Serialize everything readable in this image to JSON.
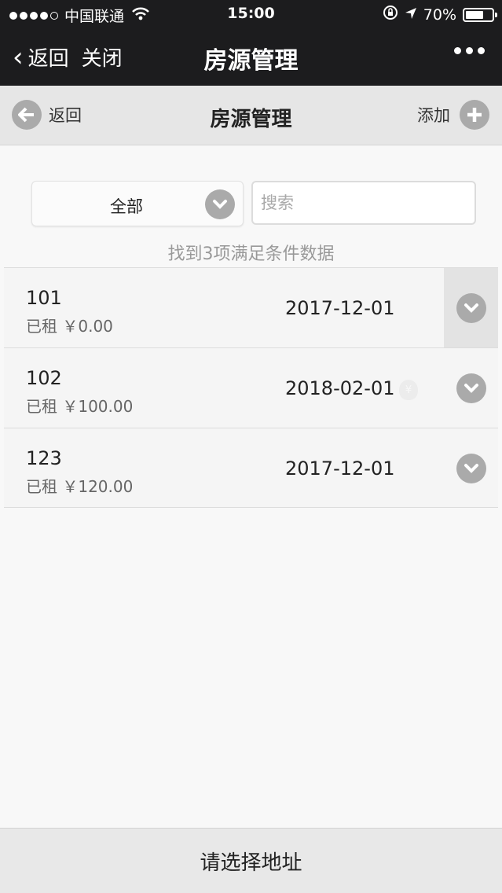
{
  "status_bar": {
    "carrier": "中国联通",
    "time": "15:00",
    "battery_percent": "70%",
    "battery_level": 0.7,
    "signal_bars_filled": 4,
    "signal_bars_total": 5,
    "icons": [
      "wifi-icon",
      "rotation-lock-icon",
      "location-arrow-icon",
      "battery-icon"
    ]
  },
  "wechat_nav": {
    "back_label": "返回",
    "close_label": "关闭",
    "title": "房源管理",
    "more_icon": "more-dots-icon"
  },
  "page_header": {
    "back_label": "返回",
    "back_icon": "arrow-left-circle-icon",
    "title": "房源管理",
    "add_label": "添加",
    "add_icon": "plus-circle-icon"
  },
  "filter": {
    "selected": "全部",
    "dropdown_icon": "chevron-down-circle-icon",
    "search_placeholder": "搜索",
    "search_value": ""
  },
  "result_count": "找到3项满足条件数据",
  "rooms": [
    {
      "number": "101",
      "status": "已租 ￥0.00",
      "date": "2017-12-01",
      "expanded": true
    },
    {
      "number": "102",
      "status": "已租 ￥100.00",
      "date": "2018-02-01",
      "expanded": false,
      "extra_icon": "money-bag-icon"
    },
    {
      "number": "123",
      "status": "已租 ￥120.00",
      "date": "2017-12-01",
      "expanded": false
    }
  ],
  "bottom_bar": {
    "label": "请选择地址"
  },
  "colors": {
    "nav_bg": "#1c1c1e",
    "header_bg": "#e6e6e6",
    "icon_gray": "#aaaaaa",
    "page_bg": "#f8f8f8"
  }
}
